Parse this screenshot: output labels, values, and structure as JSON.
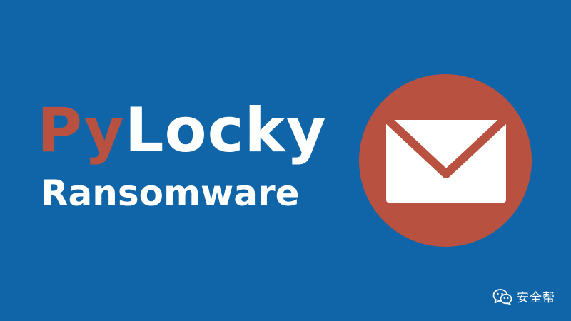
{
  "banner": {
    "title_part1": "Py",
    "title_part2": "Locky",
    "subtitle": "Ransomware"
  },
  "icon": {
    "name": "envelope-icon",
    "circle_color": "#b95140",
    "glyph_color": "#ffffff"
  },
  "watermark": {
    "icon": "wechat-icon",
    "text": "安全帮"
  },
  "colors": {
    "background": "#0f65a8",
    "accent": "#b95140",
    "text": "#ffffff"
  }
}
